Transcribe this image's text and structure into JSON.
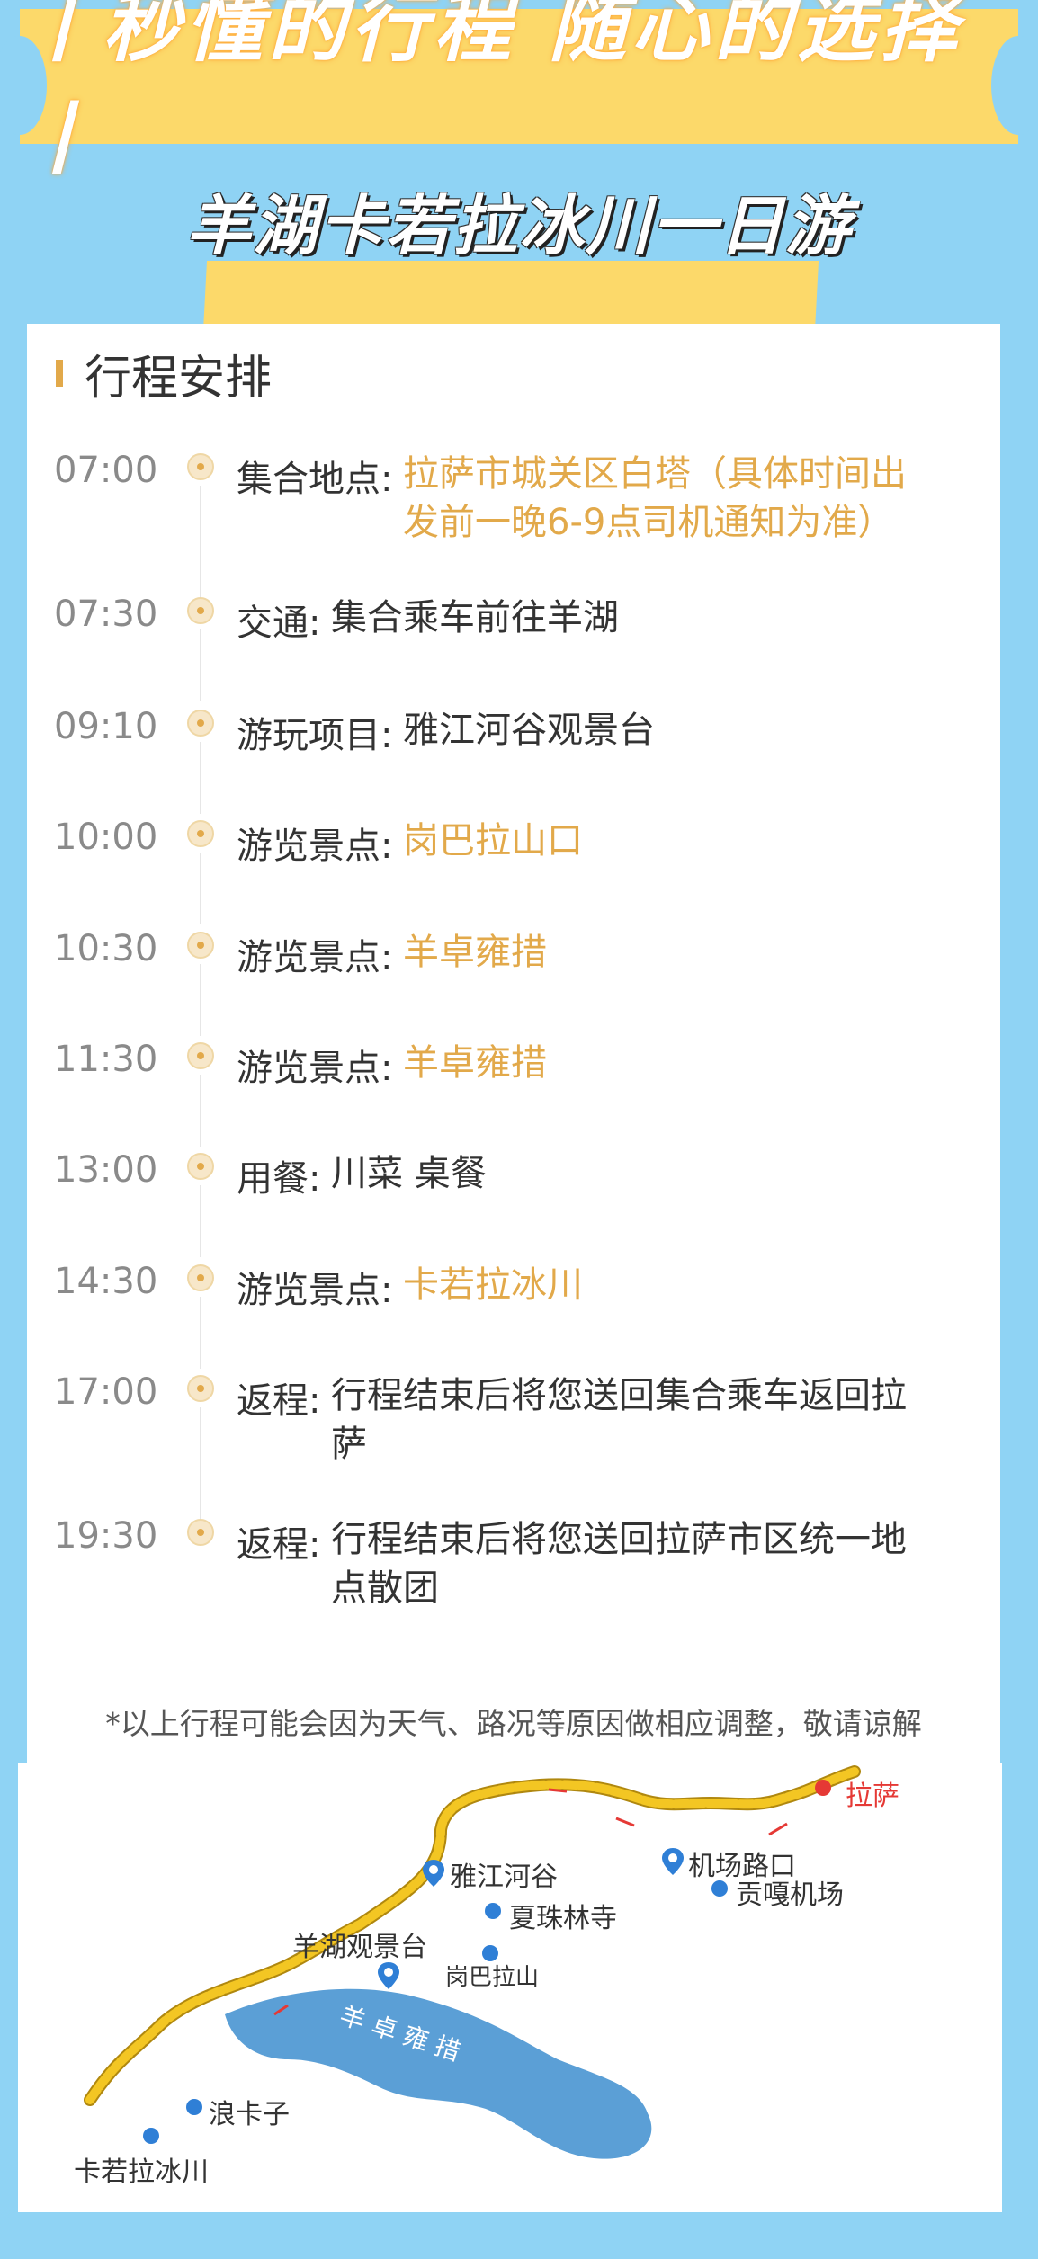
{
  "banner": {
    "title": "丨秒懂的行程 随心的选择丨"
  },
  "subtitle": "羊湖卡若拉冰川一日游",
  "section": {
    "title": "行程安排"
  },
  "itinerary": [
    {
      "time": "07:00",
      "label": "集合地点:",
      "value": "拉萨市城关区白塔（具体时间出\n发前一晚6-9点司机通知为准）",
      "highlight": true
    },
    {
      "time": "07:30",
      "label": "交通:",
      "value": "集合乘车前往羊湖",
      "highlight": false
    },
    {
      "time": "09:10",
      "label": "游玩项目:",
      "value": "雅江河谷观景台",
      "highlight": false
    },
    {
      "time": "10:00",
      "label": "游览景点:",
      "value": "岗巴拉山口",
      "highlight": true
    },
    {
      "time": "10:30",
      "label": "游览景点:",
      "value": "羊卓雍措",
      "highlight": true
    },
    {
      "time": "11:30",
      "label": "游览景点:",
      "value": "羊卓雍措",
      "highlight": true
    },
    {
      "time": "13:00",
      "label": "用餐:",
      "value": "川菜 桌餐",
      "highlight": false
    },
    {
      "time": "14:30",
      "label": "游览景点:",
      "value": "卡若拉冰川",
      "highlight": true
    },
    {
      "time": "17:00",
      "label": "返程:",
      "value": "行程结束后将您送回集合乘车返回拉\n萨",
      "highlight": false
    },
    {
      "time": "19:30",
      "label": "返程:",
      "value": "行程结束后将您送回拉萨市区统一地\n点散团",
      "highlight": false
    }
  ],
  "note": "*以上行程可能会因为天气、路况等原因做相应调整，敬请谅解",
  "map": {
    "places": {
      "lhasa": "拉萨",
      "airport_road": "机场路口",
      "gonggar_airport": "贡嘎机场",
      "yajiang_valley": "雅江河谷",
      "xiazhulin_temple": "夏珠林寺",
      "yanghu_viewpoint": "羊湖观景台",
      "gangbala": "岗巴拉山",
      "langkazi": "浪卡子",
      "karola_glacier": "卡若拉冰川",
      "lake": "羊 卓 雍 措"
    }
  },
  "colors": {
    "accent": "#e2a94a",
    "banner": "#fcd96a",
    "background": "#8fd3f4",
    "lake": "#5b9fd6",
    "route": "#f3c623",
    "marker_red": "#e53935",
    "marker_blue": "#2f7fd6"
  }
}
